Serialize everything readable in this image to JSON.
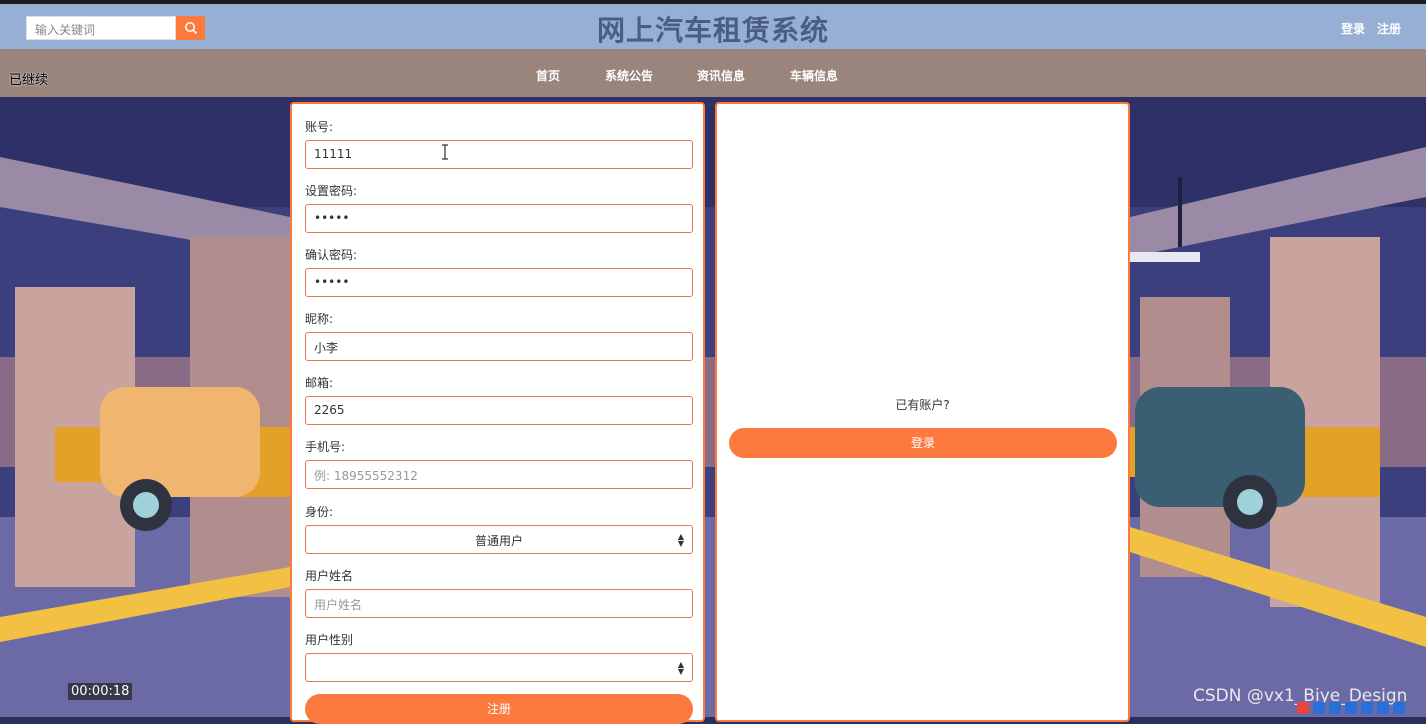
{
  "header": {
    "search_placeholder": "输入关键词",
    "title": "网上汽车租赁系统",
    "login_link": "登录",
    "register_link": "注册"
  },
  "nav": {
    "continued_label": "已继续",
    "items": [
      "首页",
      "系统公告",
      "资讯信息",
      "车辆信息"
    ]
  },
  "form": {
    "fields": [
      {
        "label": "账号:",
        "value": "11111",
        "placeholder": ""
      },
      {
        "label": "设置密码:",
        "value": "•••••",
        "placeholder": ""
      },
      {
        "label": "确认密码:",
        "value": "•••••",
        "placeholder": ""
      },
      {
        "label": "昵称:",
        "value": "小李",
        "placeholder": ""
      },
      {
        "label": "邮箱:",
        "value": "2265",
        "placeholder": ""
      },
      {
        "label": "手机号:",
        "value": "",
        "placeholder": "例: 18955552312"
      },
      {
        "label": "身份:",
        "value": "普通用户",
        "placeholder": ""
      },
      {
        "label": "用户姓名",
        "value": "",
        "placeholder": "用户姓名"
      },
      {
        "label": "用户性别",
        "value": "",
        "placeholder": ""
      }
    ],
    "submit_label": "注册"
  },
  "side": {
    "question": "已有账户?",
    "login_button": "登录"
  },
  "overlay": {
    "timer": "00:00:18",
    "watermark": "CSDN @vx1_Biye_Design"
  },
  "colors": {
    "accent": "#fc7a3e",
    "header_bg": "#97afd4",
    "nav_bg": "#9a857c",
    "title_color": "#4a5d83"
  }
}
